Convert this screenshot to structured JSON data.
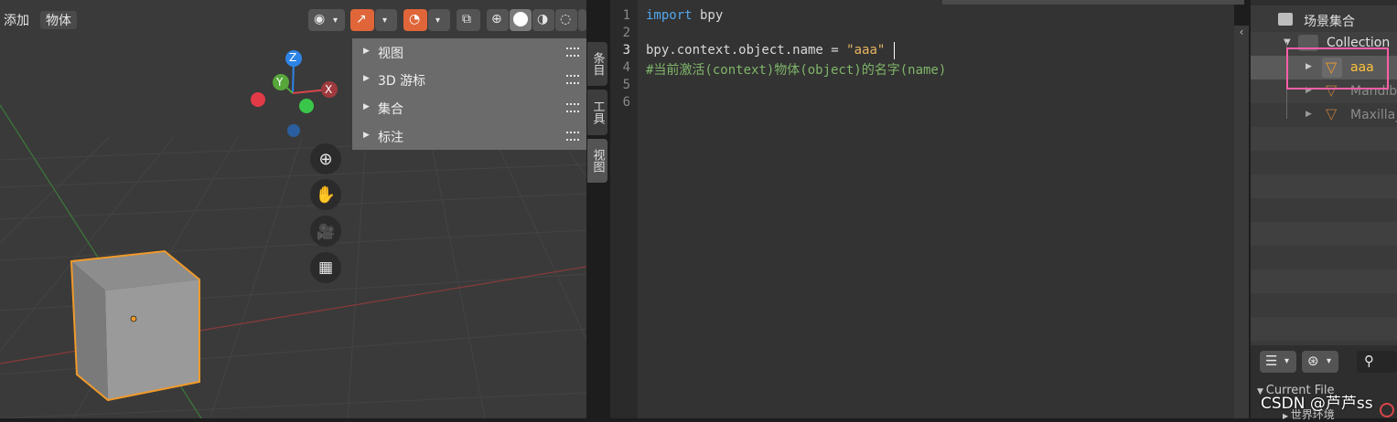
{
  "viewport": {
    "menu": [
      "添加",
      "物体"
    ],
    "npanel_items": [
      "视图",
      "3D 游标",
      "集合",
      "标注"
    ],
    "side_tabs": [
      "条目",
      "工具",
      "视图"
    ],
    "gizmo_axes": {
      "x": "X",
      "y": "Y",
      "z": "Z"
    },
    "colors": {
      "x": "#d9464b",
      "y": "#56a63a",
      "z": "#2e84e6",
      "selected": "#f09a2a"
    }
  },
  "editor": {
    "line_numbers": [
      "1",
      "2",
      "3",
      "4",
      "5",
      "6"
    ],
    "lines": {
      "l1_kw": "import",
      "l1_rest": " bpy",
      "l3_code": "bpy.context.object.name = ",
      "l3_str": "\"aaa\"",
      "l4_comment": "#当前激活(context)物体(object)的名字(name)"
    }
  },
  "outliner": {
    "scene_collection": "场景集合",
    "collection": "Collection",
    "items": [
      "aaa",
      "Mandib",
      "Maxilla_"
    ],
    "current_file": "Current File",
    "world": "世界环境"
  },
  "watermark": "CSDN @芦芦ss"
}
